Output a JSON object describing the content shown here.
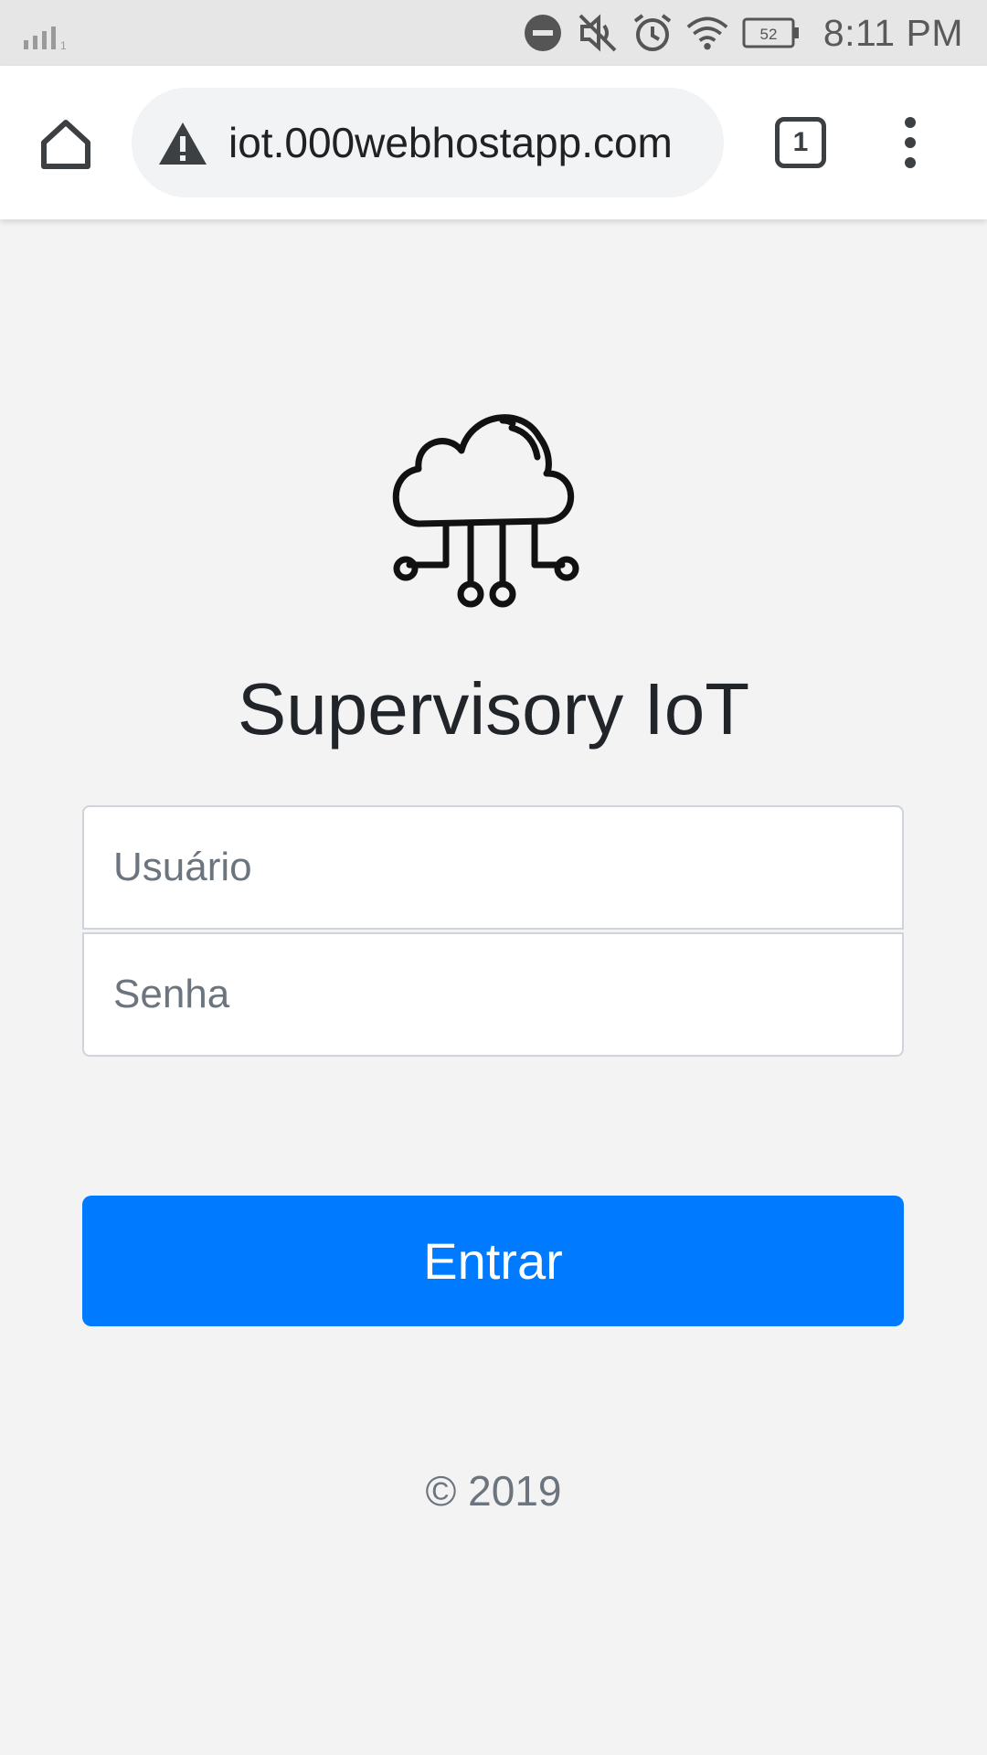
{
  "status_bar": {
    "time": "8:11 PM",
    "battery_level": "52",
    "icons": [
      "signal-icon",
      "do-not-disturb-icon",
      "mute-icon",
      "alarm-icon",
      "wifi-icon",
      "battery-icon"
    ]
  },
  "browser": {
    "url": "iot.000webhostapp.com",
    "tab_count": "1",
    "icons": [
      "home-icon",
      "warning-icon",
      "tabs-icon",
      "more-menu-icon"
    ]
  },
  "page": {
    "logo_icon": "cloud-iot-icon",
    "title": "Supervisory IoT",
    "username_placeholder": "Usuário",
    "password_placeholder": "Senha",
    "submit_label": "Entrar",
    "footer": "© 2019",
    "accent_color": "#007bff"
  }
}
